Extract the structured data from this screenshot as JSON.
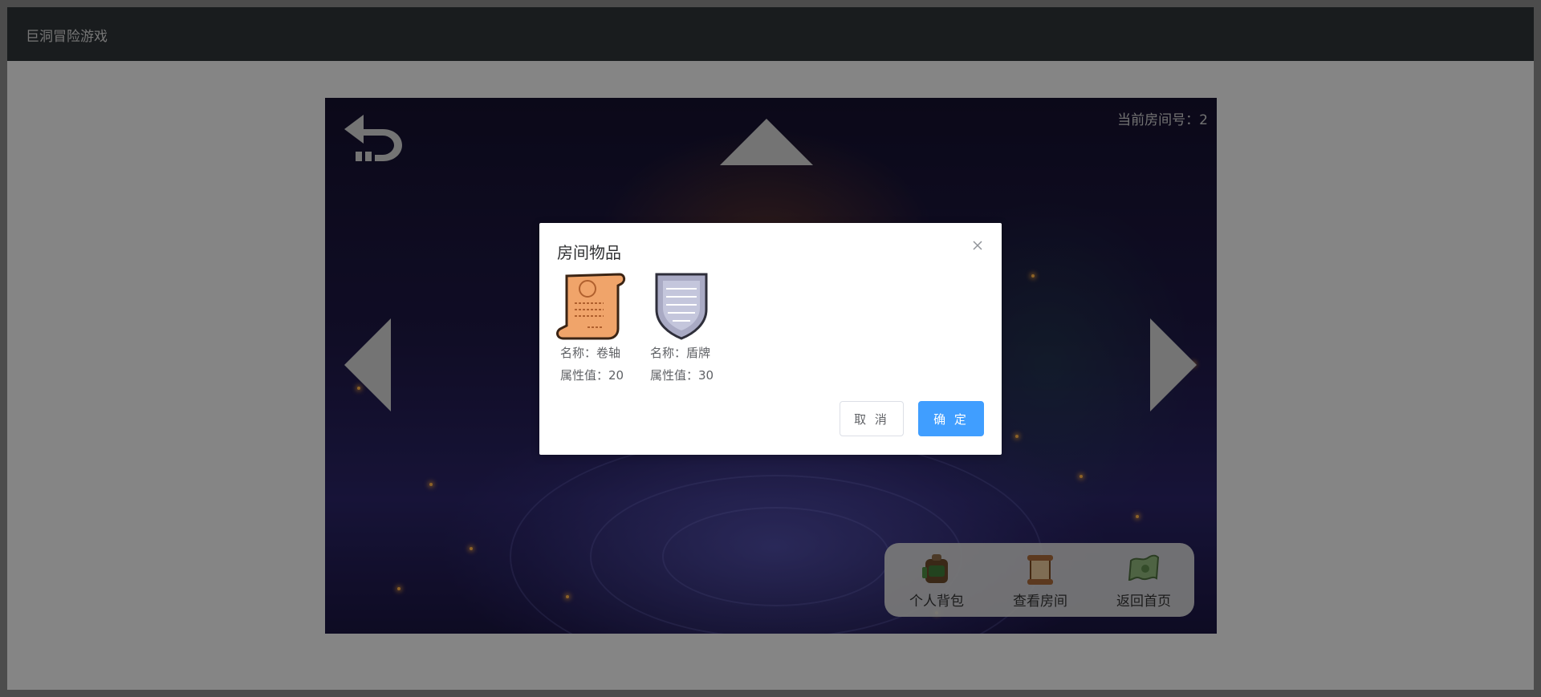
{
  "app": {
    "title": "巨洞冒险游戏"
  },
  "game": {
    "room_label": "当前房间号：2",
    "toolbar": [
      {
        "label": "个人背包",
        "icon": "backpack-icon"
      },
      {
        "label": "查看房间",
        "icon": "scroll-map-icon"
      },
      {
        "label": "返回首页",
        "icon": "home-map-icon"
      }
    ]
  },
  "dialog": {
    "title": "房间物品",
    "items": [
      {
        "name_line": "名称：卷轴",
        "attr_line": "属性值：20",
        "icon": "scroll-icon"
      },
      {
        "name_line": "名称：盾牌",
        "attr_line": "属性值：30",
        "icon": "shield-icon"
      }
    ],
    "cancel_label": "取 消",
    "confirm_label": "确 定"
  },
  "colors": {
    "primary": "#409eff",
    "topbar": "#2e3337",
    "arrow": "#d3d3d3"
  }
}
